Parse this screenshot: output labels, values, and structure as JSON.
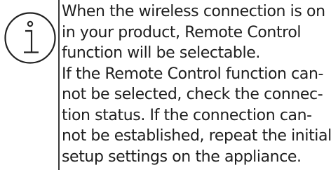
{
  "notice": {
    "icon": "info-icon",
    "lines": [
      "When the wireless connection is on",
      "in your product, Remote Control",
      "function will be selectable.",
      "If the Remote Control function can-",
      "not be selected, check the connec-",
      "tion status. If the connection can-",
      "not be established, repeat the initial",
      "setup settings on the appliance."
    ]
  },
  "colors": {
    "text": "#1e1e1e",
    "icon_stroke": "#222222",
    "divider": "#3a3a3a"
  }
}
